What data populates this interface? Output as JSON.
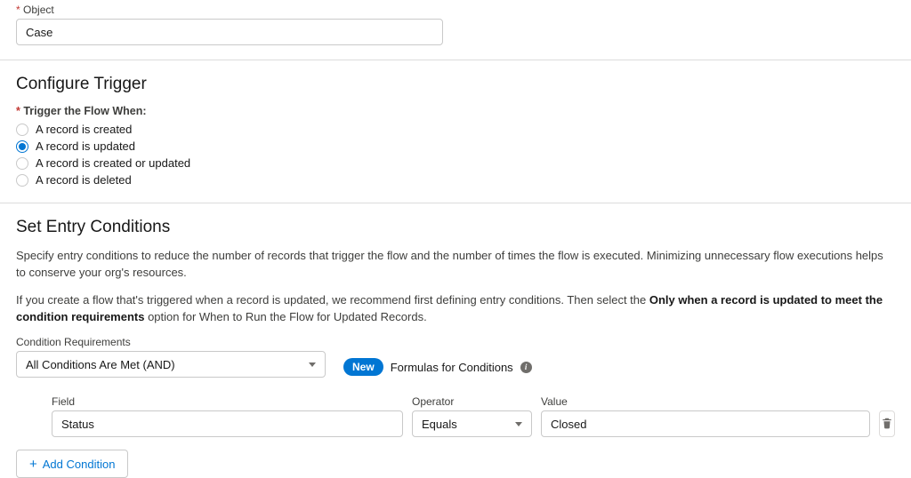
{
  "object": {
    "label": "Object",
    "value": "Case"
  },
  "trigger": {
    "heading": "Configure Trigger",
    "when_label": "Trigger the Flow When:",
    "options": [
      {
        "label": "A record is created",
        "selected": false
      },
      {
        "label": "A record is updated",
        "selected": true
      },
      {
        "label": "A record is created or updated",
        "selected": false
      },
      {
        "label": "A record is deleted",
        "selected": false
      }
    ]
  },
  "entry": {
    "heading": "Set Entry Conditions",
    "desc1": "Specify entry conditions to reduce the number of records that trigger the flow and the number of times the flow is executed. Minimizing unnecessary flow executions helps to conserve your org's resources.",
    "desc2_pre": "If you create a flow that's triggered when a record is updated, we recommend first defining entry conditions. Then select the ",
    "desc2_bold": "Only when a record is updated to meet the condition requirements",
    "desc2_post": " option for When to Run the Flow for Updated Records.",
    "cond_req_label": "Condition Requirements",
    "cond_req_value": "All Conditions Are Met (AND)",
    "new_badge": "New",
    "new_text": "Formulas for Conditions",
    "row": {
      "field_label": "Field",
      "field_value": "Status",
      "op_label": "Operator",
      "op_value": "Equals",
      "val_label": "Value",
      "val_value": "Closed"
    },
    "add_btn": "Add Condition"
  }
}
